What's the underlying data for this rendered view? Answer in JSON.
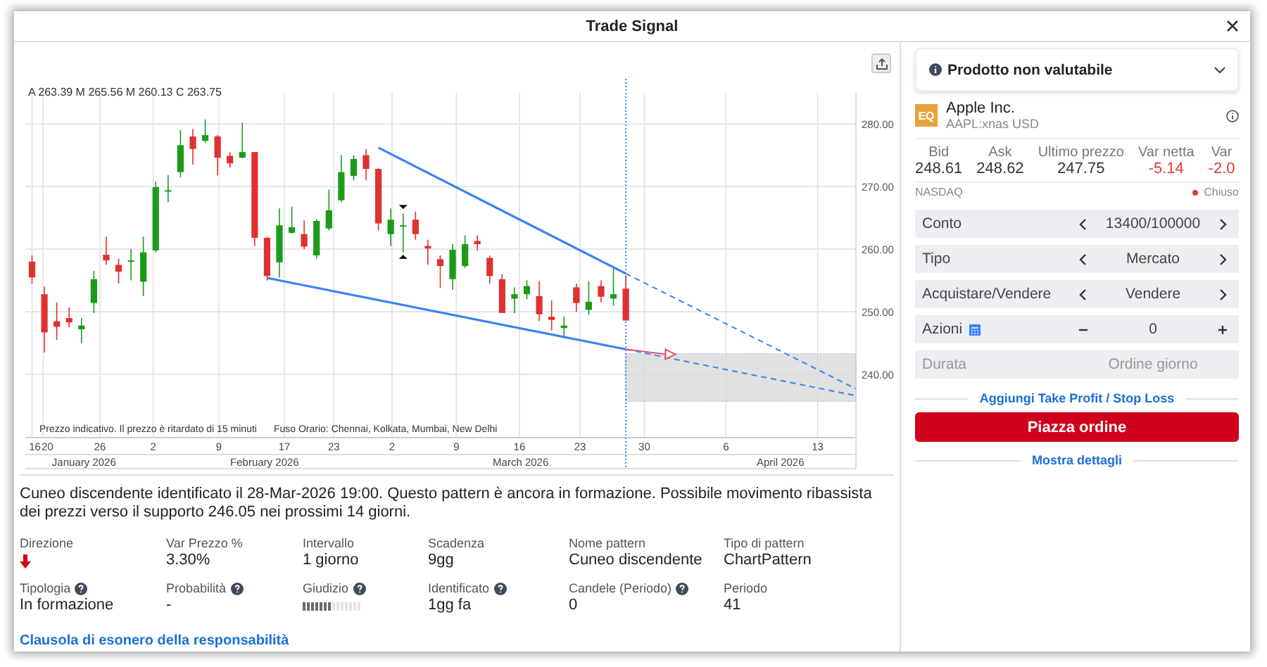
{
  "window": {
    "title": "Trade Signal"
  },
  "chart": {
    "ohlc_readout": "A 263.39   M 265.56   M 260.13   C 263.75",
    "notes": [
      "Prezzo indicativo. Il prezzo è ritardato di 15 minuti",
      "Fuso Orario: Chennai, Kolkata, Mumbai, New Delhi"
    ],
    "price_labels": [
      "280.00",
      "270.00",
      "260.00",
      "250.00",
      "240.00"
    ],
    "date_labels": [
      "16",
      "20",
      "26",
      "2",
      "9",
      "17",
      "23",
      "2",
      "9",
      "16",
      "23",
      "30",
      "6",
      "13"
    ],
    "month_labels": [
      "January 2026",
      "February 2026",
      "March 2026",
      "April 2026"
    ]
  },
  "summary": "Cuneo discendente identificato il 28-Mar-2026 19:00. Questo pattern è ancora in formazione. Possibile movimento ribassista dei prezzi verso il supporto 246.05 nei prossimi 14 giorni.",
  "details": [
    {
      "label": "Direzione",
      "kind": "direction",
      "info": false
    },
    {
      "label": "Var Prezzo %",
      "kind": "text",
      "value": "3.30%",
      "info": false
    },
    {
      "label": "Intervallo",
      "kind": "text",
      "value": "1 giorno",
      "info": false
    },
    {
      "label": "Scadenza",
      "kind": "text",
      "value": "9gg",
      "info": false
    },
    {
      "label": "Nome pattern",
      "kind": "text",
      "value": "Cuneo discendente",
      "info": false
    },
    {
      "label": "Tipo di pattern",
      "kind": "text",
      "value": "ChartPattern",
      "info": false
    },
    {
      "label": "Tipologia",
      "kind": "text",
      "value": "In formazione",
      "info": true
    },
    {
      "label": "Probabilità",
      "kind": "text",
      "value": "-",
      "info": true
    },
    {
      "label": "Giudizio",
      "kind": "meter",
      "level": 0.5,
      "info": true
    },
    {
      "label": "Identificato",
      "kind": "text",
      "value": "1gg fa",
      "info": true
    },
    {
      "label": "Candele (Periodo)",
      "kind": "text",
      "value": "0",
      "info": true
    },
    {
      "label": "Periodo",
      "kind": "text",
      "value": "41",
      "info": false
    }
  ],
  "disclaimer_link": "Clausola di esonero della responsabilità",
  "order_panel": {
    "product_status": "Prodotto non valutabile",
    "instrument": {
      "badge": "EQ",
      "name": "Apple Inc.",
      "ticker": "AAPL:xnas USD"
    },
    "quotes": [
      {
        "label": "Bid",
        "value": "248.61",
        "negative": false
      },
      {
        "label": "Ask",
        "value": "248.62",
        "negative": false
      },
      {
        "label": "Ultimo prezzo",
        "value": "247.75",
        "negative": false
      },
      {
        "label": "Var netta",
        "value": "-5.14",
        "negative": true
      },
      {
        "label": "Var",
        "value": "-2.0",
        "negative": true
      }
    ],
    "exchange": "NASDAQ",
    "market_status": "Chiuso",
    "market_open": false,
    "fields": [
      {
        "kind": "stepper",
        "label": "Conto",
        "value": "13400/100000",
        "disabled": false
      },
      {
        "kind": "stepper",
        "label": "Tipo",
        "value": "Mercato",
        "disabled": false
      },
      {
        "kind": "stepper",
        "label": "Acquistare/Vendere",
        "value": "Vendere",
        "disabled": false
      },
      {
        "kind": "quantity",
        "label": "Azioni",
        "value": "0",
        "disabled": false
      },
      {
        "kind": "plain",
        "label": "Durata",
        "value": "Ordine giorno",
        "disabled": true
      }
    ],
    "tp_sl_link": "Aggiungi Take Profit / Stop Loss",
    "submit": "Piazza ordine",
    "details_link": "Mostra dettagli"
  }
}
